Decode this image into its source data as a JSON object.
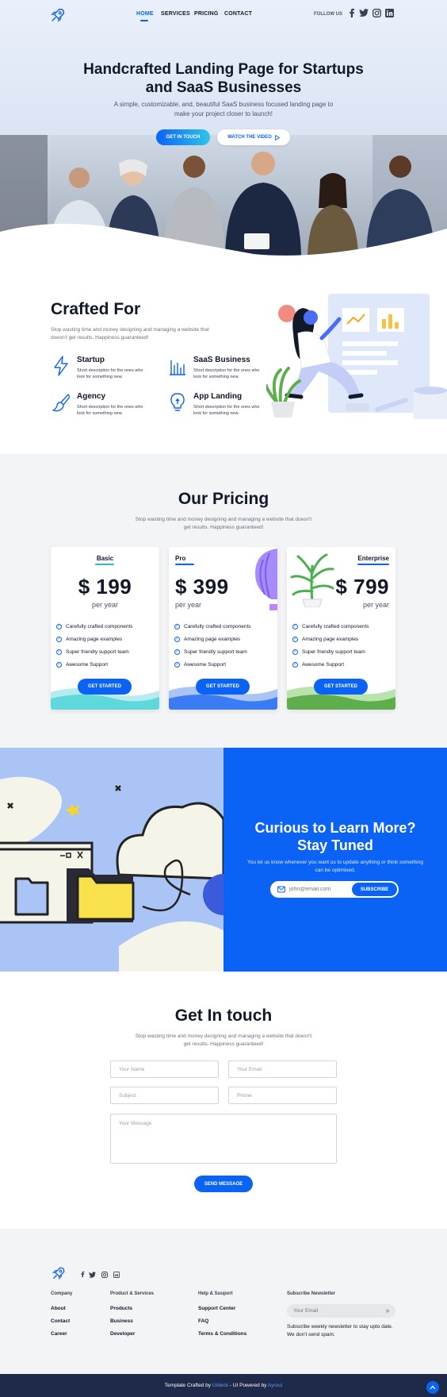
{
  "nav": {
    "links": [
      "HOME",
      "SERVICES",
      "PRICING",
      "CONTACT"
    ],
    "follow_label": "FOLLOW US",
    "social_icons": [
      "facebook-icon",
      "twitter-icon",
      "instagram-icon",
      "linkedin-icon"
    ]
  },
  "hero": {
    "title": "Handcrafted Landing Page for Startups and SaaS Businesses",
    "subtitle": "A simple, customizable, and, beautiful SaaS business focused landing page to make your project closer to launch!",
    "primary_button": "GET IN TOUCH",
    "secondary_button": "WATCH THE VIDEO"
  },
  "crafted": {
    "title": "Crafted For",
    "subtitle": "Stop wasting time and money designing and managing a website that doesn't get results. Happiness guaranteed!",
    "features": [
      {
        "title": "Startup",
        "desc": "Short description for the ones who look for something new.",
        "icon": "lightning-icon"
      },
      {
        "title": "SaaS Business",
        "desc": "Short description for the ones who look for something new.",
        "icon": "bar-chart-icon"
      },
      {
        "title": "Agency",
        "desc": "Short description for the ones who look for something new.",
        "icon": "brush-icon"
      },
      {
        "title": "App Landing",
        "desc": "Short description for the ones who look for something new.",
        "icon": "lightbulb-icon"
      }
    ]
  },
  "pricing": {
    "title": "Our Pricing",
    "subtitle": "Stop wasting time and money designing and managing a website that doesn't get results. Happiness guaranteed!",
    "plans": [
      {
        "name": "Basic",
        "price": "$ 199",
        "period": "per year",
        "button": "GET STARTED",
        "accent": "#22c1c3",
        "features": [
          "Carefully crafted components",
          "Amazing page examples",
          "Super friendly support team",
          "Awesome Support"
        ]
      },
      {
        "name": "Pro",
        "price": "$ 399",
        "period": "per year",
        "button": "GET STARTED",
        "accent": "#0B63F6",
        "features": [
          "Carefully crafted components",
          "Amazing page examples",
          "Super friendly support team",
          "Awesome Support"
        ]
      },
      {
        "name": "Enterprise",
        "price": "$ 799",
        "period": "per year",
        "button": "GET STARTED",
        "accent": "#0B63F6",
        "features": [
          "Carefully crafted components",
          "Amazing page examples",
          "Super friendly support team",
          "Awesome Support"
        ]
      }
    ]
  },
  "subscribe": {
    "title": "Curious to Learn More? Stay Tuned",
    "text": "You let us know whenever you want us to update anything or think something can be optimised.",
    "placeholder": "john@email.com",
    "button": "SUBSCRIBE"
  },
  "contact": {
    "title": "Get In touch",
    "subtitle": "Stop wasting time and money designing and managing a website that doesn't get results. Happiness guaranteed!",
    "name_placeholder": "Your Name",
    "email_placeholder": "Your Email",
    "subject_placeholder": "Subject",
    "phone_placeholder": "Phone",
    "message_placeholder": "Your Message",
    "button": "SEND MESSAGE"
  },
  "footer": {
    "columns": [
      {
        "heading": "Company",
        "items": [
          "About",
          "Contact",
          "Career"
        ]
      },
      {
        "heading": "Product & Services",
        "items": [
          "Products",
          "Business",
          "Developer"
        ]
      },
      {
        "heading": "Help & Suuport",
        "items": [
          "Support Center",
          "FAQ",
          "Terms & Conditions"
        ]
      }
    ],
    "newsletter_heading": "Subscribe Newsletter",
    "newsletter_placeholder": "Your Email",
    "newsletter_text": "Subscribe weekly newsletter to stay upto date. We don't send spam.",
    "copy_prefix": "Template Crafted by",
    "copy_link1": "UIdeck",
    "copy_middle": "- UI Powered by",
    "copy_link2": "Ayroui"
  },
  "colors": {
    "primary": "#0B63F6",
    "dark": "#1f2a4a",
    "teal": "#22c1c3",
    "green": "#5fae4e"
  }
}
